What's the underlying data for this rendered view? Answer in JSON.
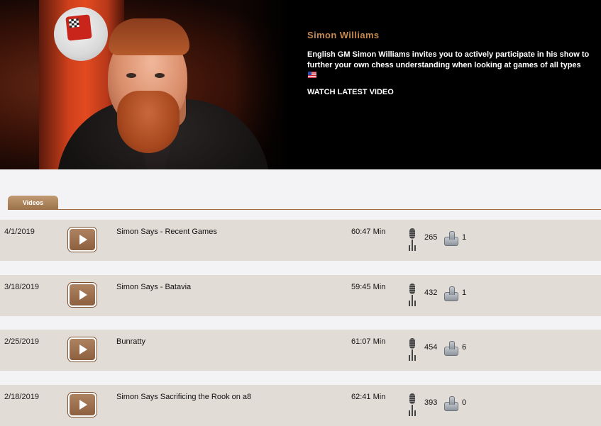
{
  "hero": {
    "host_name": "Simon Williams",
    "description": "English GM Simon Williams invites you to actively participate in his show to further your own chess understanding when looking at games of all types",
    "flag_icon": "us-flag-icon",
    "watch_label": "WATCH LATEST VIDEO"
  },
  "tabs": [
    {
      "label": "Videos",
      "active": true
    }
  ],
  "videos": [
    {
      "date": "4/1/2019",
      "title": "Simon Says - Recent Games",
      "duration": "60:47 Min",
      "plays": "265",
      "likes": "1"
    },
    {
      "date": "3/18/2019",
      "title": "Simon Says - Batavia",
      "duration": "59:45 Min",
      "plays": "432",
      "likes": "1"
    },
    {
      "date": "2/25/2019",
      "title": "Bunratty",
      "duration": "61:07 Min",
      "plays": "454",
      "likes": "6"
    },
    {
      "date": "2/18/2019",
      "title": "Simon Says Sacrificing the Rook on a8",
      "duration": "62:41 Min",
      "plays": "393",
      "likes": "0"
    }
  ],
  "colors": {
    "accent": "#c8894e",
    "tab": "#9b7249",
    "row_background": "#e2dcd6",
    "page_background": "#f3f3f5"
  }
}
